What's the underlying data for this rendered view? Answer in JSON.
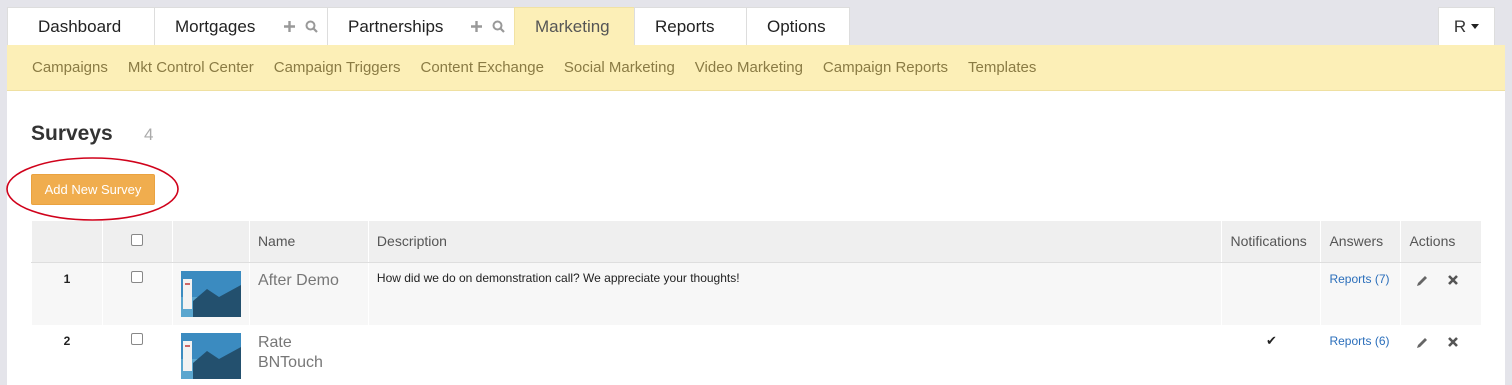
{
  "top_tabs": [
    {
      "label": "Dashboard"
    },
    {
      "label": "Mortgages"
    },
    {
      "label": "Partnerships"
    },
    {
      "label": "Marketing"
    },
    {
      "label": "Reports"
    },
    {
      "label": "Options"
    }
  ],
  "user_menu": {
    "label": "R"
  },
  "sub_nav": [
    "Campaigns",
    "Mkt Control Center",
    "Campaign Triggers",
    "Content Exchange",
    "Social Marketing",
    "Video Marketing",
    "Campaign Reports",
    "Templates"
  ],
  "page": {
    "title": "Surveys",
    "count": "4",
    "add_button": "Add New Survey"
  },
  "table": {
    "headers": {
      "name": "Name",
      "description": "Description",
      "notifications": "Notifications",
      "answers": "Answers",
      "actions": "Actions"
    },
    "rows": [
      {
        "num": "1",
        "name": "After Demo",
        "description": "How did we do on demonstration call? We appreciate your thoughts!",
        "notifications": "",
        "answers": "Reports (7)"
      },
      {
        "num": "2",
        "name": "Rate BNTouch",
        "description": "",
        "notifications": "✔",
        "answers": "Reports (6)"
      }
    ]
  },
  "colors": {
    "accent_button": "#f0ad4e",
    "subnav_bg": "#fcefb7",
    "link": "#2a6ebb",
    "highlight_ring": "#d0021b"
  }
}
